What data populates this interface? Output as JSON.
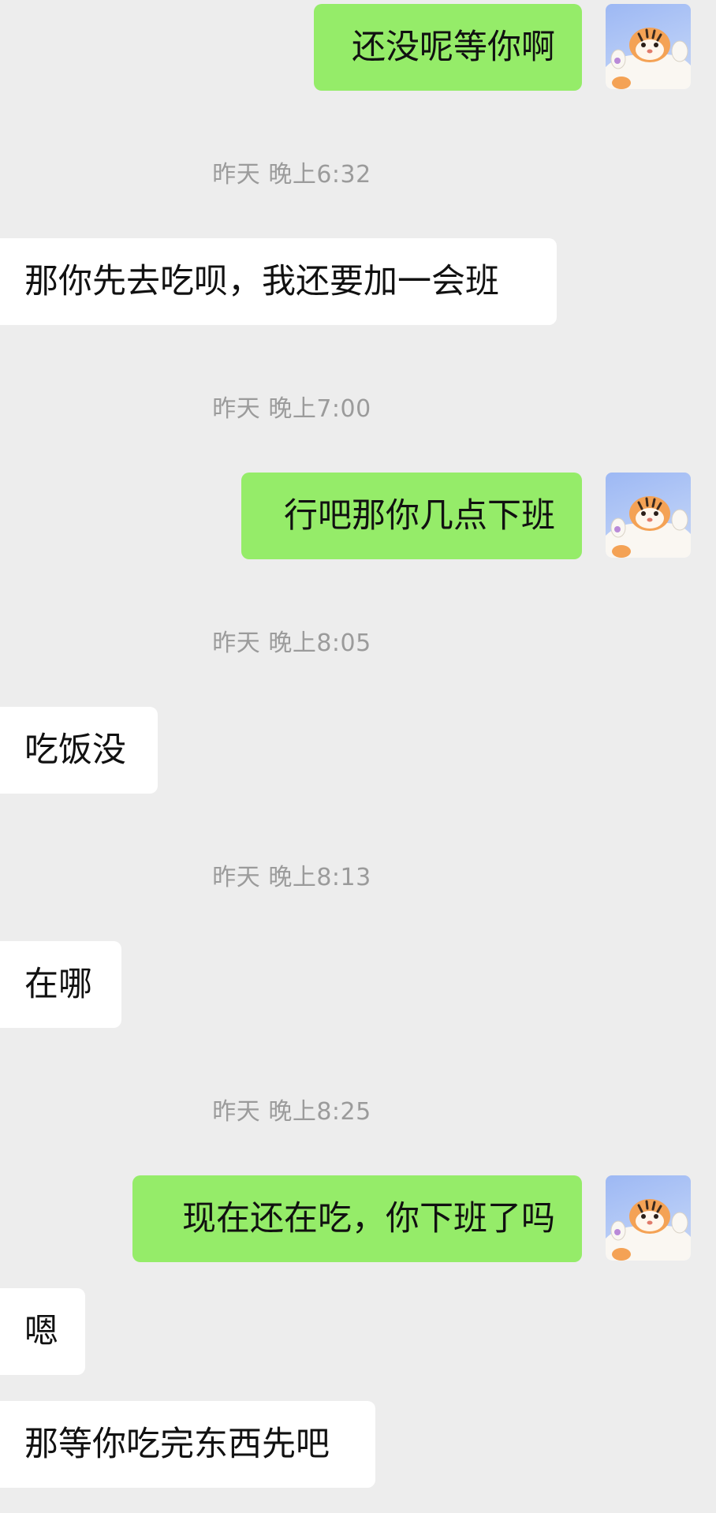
{
  "chat": {
    "messages": [
      {
        "type": "message",
        "side": "me",
        "text": "还没呢等你啊"
      },
      {
        "type": "time",
        "text": "昨天 晚上6:32"
      },
      {
        "type": "message",
        "side": "other",
        "text": "那你先去吃呗，我还要加一会班"
      },
      {
        "type": "time",
        "text": "昨天 晚上7:00"
      },
      {
        "type": "message",
        "side": "me",
        "text": "行吧那你几点下班"
      },
      {
        "type": "time",
        "text": "昨天 晚上8:05"
      },
      {
        "type": "message",
        "side": "other",
        "text": "吃饭没"
      },
      {
        "type": "time",
        "text": "昨天 晚上8:13"
      },
      {
        "type": "message",
        "side": "other",
        "text": "在哪"
      },
      {
        "type": "time",
        "text": "昨天 晚上8:25"
      },
      {
        "type": "message",
        "side": "me",
        "text": "现在还在吃，你下班了吗"
      },
      {
        "type": "message",
        "side": "other",
        "text": "嗯"
      },
      {
        "type": "message",
        "side": "other",
        "text": "那等你吃完东西先吧"
      }
    ],
    "my_avatar_icon": "tiger-cartoon-avatar-icon"
  },
  "colors": {
    "background": "#EDEDED",
    "my_bubble": "#95EC69",
    "other_bubble": "#FFFFFF",
    "timestamp_text": "#9B9B9B"
  }
}
